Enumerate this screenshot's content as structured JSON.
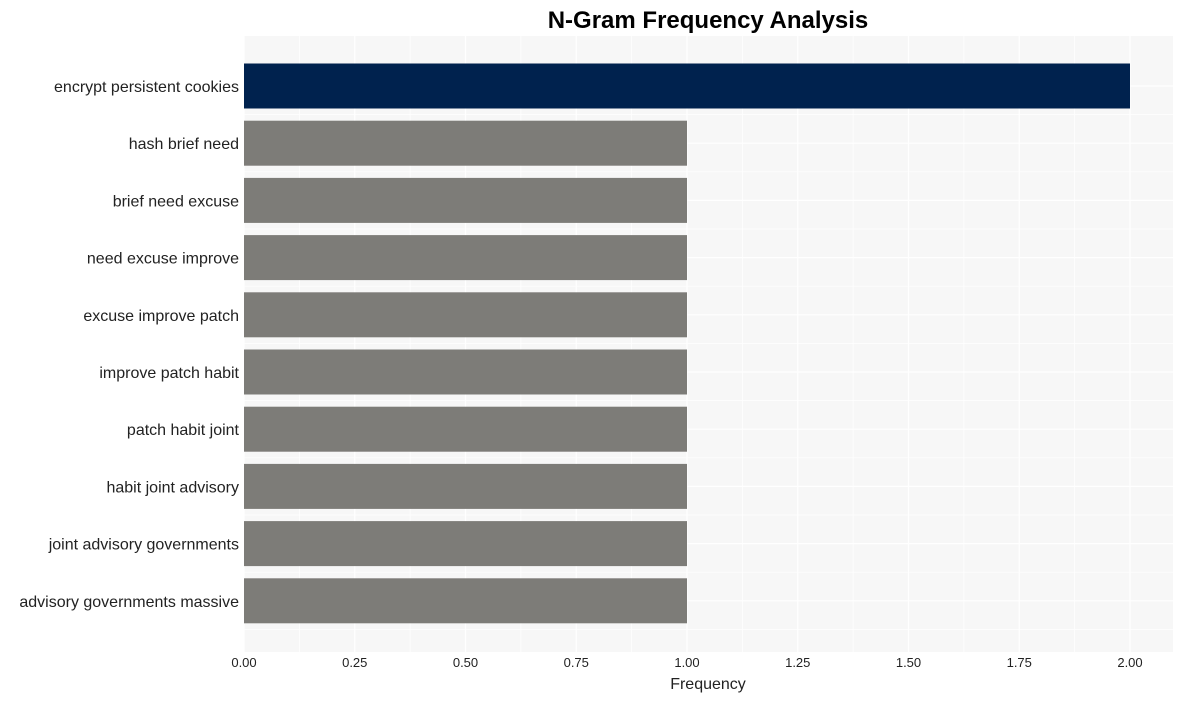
{
  "chart_data": {
    "type": "bar",
    "orientation": "horizontal",
    "title": "N-Gram Frequency Analysis",
    "xlabel": "Frequency",
    "ylabel": "",
    "xlim": [
      0,
      2.1
    ],
    "xticks": [
      0.0,
      0.25,
      0.5,
      0.75,
      1.0,
      1.25,
      1.5,
      1.75,
      2.0
    ],
    "xtick_labels": [
      "0.00",
      "0.25",
      "0.50",
      "0.75",
      "1.00",
      "1.25",
      "1.50",
      "1.75",
      "2.00"
    ],
    "grid": true,
    "categories": [
      "encrypt persistent cookies",
      "hash brief need",
      "brief need excuse",
      "need excuse improve",
      "excuse improve patch",
      "improve patch habit",
      "patch habit joint",
      "habit joint advisory",
      "joint advisory governments",
      "advisory governments massive"
    ],
    "values": [
      2,
      1,
      1,
      1,
      1,
      1,
      1,
      1,
      1,
      1
    ],
    "colors": {
      "highlight": "#00224e",
      "default": "#7d7c78",
      "plot_background": "#f7f7f7",
      "grid": "#ffffff"
    }
  }
}
